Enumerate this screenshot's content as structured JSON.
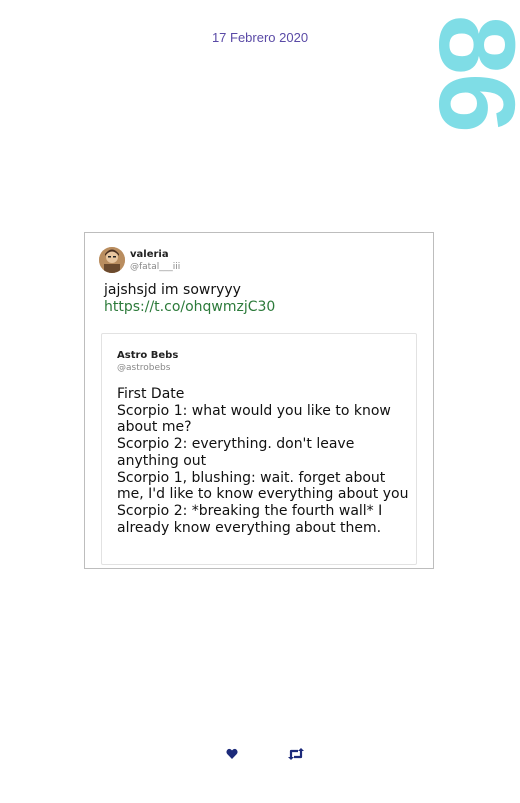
{
  "header": {
    "date": "17 Febrero 2020",
    "page_number": "86"
  },
  "tweet": {
    "author_name": "valeria",
    "author_handle": "@fatal___iii",
    "text": "jajshsjd im sowryyy",
    "link": "https://t.co/ohqwmzjC30",
    "quoted": {
      "author_name": "Astro Bebs",
      "author_handle": "@astrobebs",
      "text": "First Date\nScorpio 1: what would you like to know about me?\nScorpio 2: everything. don't leave anything out\nScorpio 1, blushing: wait. forget about me, I'd like to know everything about you\nScorpio 2: *breaking the fourth wall* I already know everything about them."
    }
  },
  "actions": {
    "like_icon": "heart-icon",
    "retweet_icon": "retweet-icon"
  },
  "colors": {
    "date": "#5a4aa6",
    "page_number": "#7fdde6",
    "link": "#2c7a3a",
    "icons": "#1c2a7a"
  }
}
